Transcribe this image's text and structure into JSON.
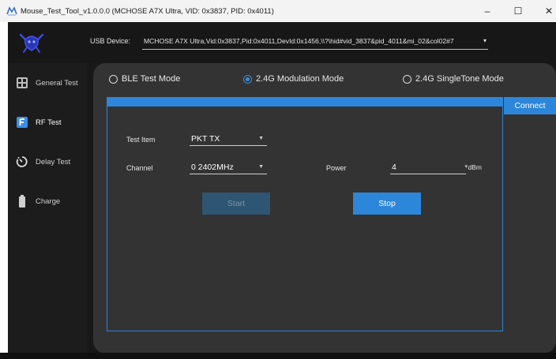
{
  "window": {
    "title": "Mouse_Test_Tool_v1.0.0.0  (MCHOSE A7X Ultra, VID: 0x3837, PID: 0x4011)",
    "minimize": "–",
    "maximize": "☐",
    "close": "✕"
  },
  "header": {
    "usb_label": "USB Device:",
    "usb_device": "MCHOSE A7X Ultra,Vid:0x3837,Pid:0x4011,DevId:0x1456,\\\\?\\hid#vid_3837&pid_4011&mi_02&col02#7"
  },
  "sidebar": {
    "items": [
      {
        "label": "General Test",
        "icon": "grid-icon"
      },
      {
        "label": "RF Test",
        "icon": "f-icon",
        "active": true
      },
      {
        "label": "Delay Test",
        "icon": "timer-icon"
      },
      {
        "label": "Charge",
        "icon": "battery-icon"
      }
    ]
  },
  "modes": [
    {
      "label": "BLE Test Mode",
      "checked": false
    },
    {
      "label": "2.4G Modulation Mode",
      "checked": true
    },
    {
      "label": "2.4G SingleTone Mode",
      "checked": false
    }
  ],
  "connect_label": "Connect",
  "form": {
    "test_item_label": "Test Item",
    "test_item_value": "PKT TX",
    "channel_label": "Channel",
    "channel_value": "0  2402MHz",
    "power_label": "Power",
    "power_value": "4",
    "power_unit": "dBm",
    "start_label": "Start",
    "stop_label": "Stop"
  },
  "colors": {
    "accent": "#2c86da",
    "panel": "#333333",
    "background": "#181818",
    "start_disabled": "#2e5572"
  }
}
